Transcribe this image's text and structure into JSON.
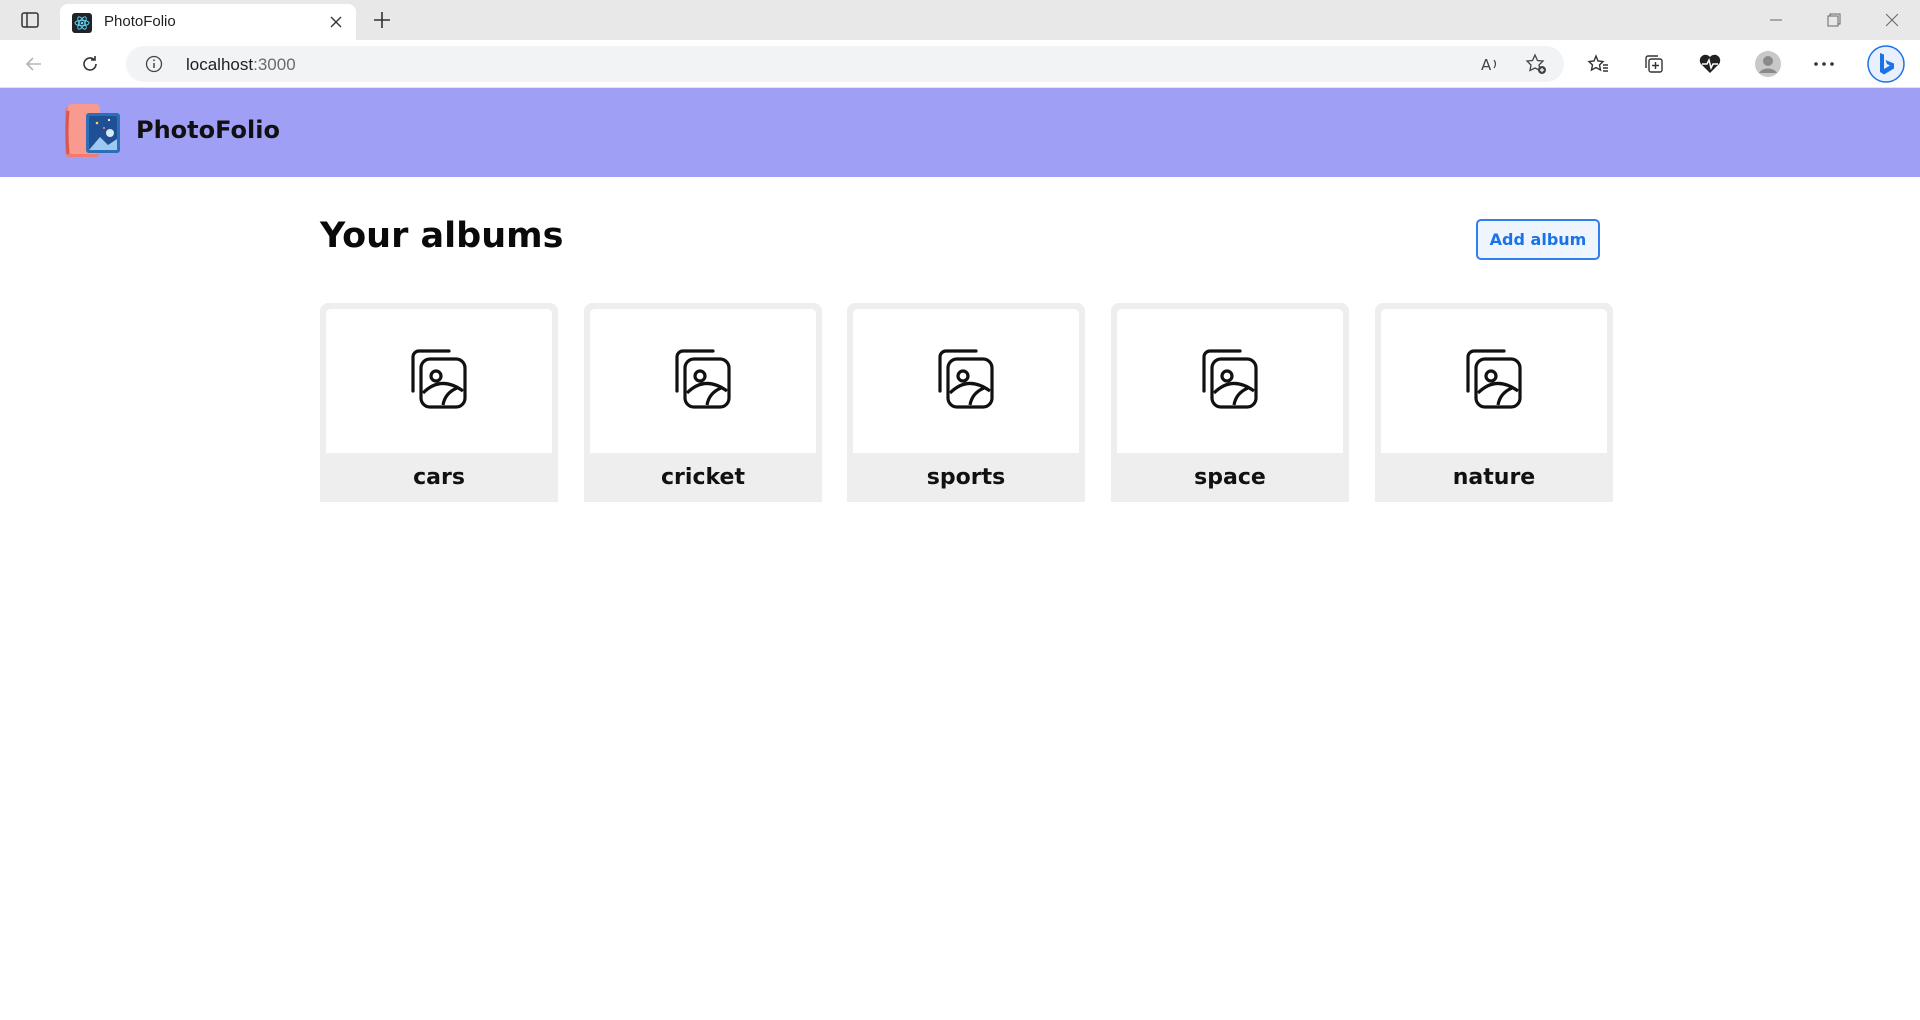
{
  "browser": {
    "tab": {
      "title": "PhotoFolio"
    },
    "address": {
      "host": "localhost",
      "port": ":3000"
    }
  },
  "app": {
    "brand": "PhotoFolio",
    "page_title": "Your albums",
    "add_album_label": "Add album",
    "albums": [
      {
        "name": "cars"
      },
      {
        "name": "cricket"
      },
      {
        "name": "sports"
      },
      {
        "name": "space"
      },
      {
        "name": "nature"
      }
    ]
  },
  "colors": {
    "header_bg": "#a09ff6",
    "accent": "#1a73e8",
    "card_bg": "#eeeeee"
  }
}
